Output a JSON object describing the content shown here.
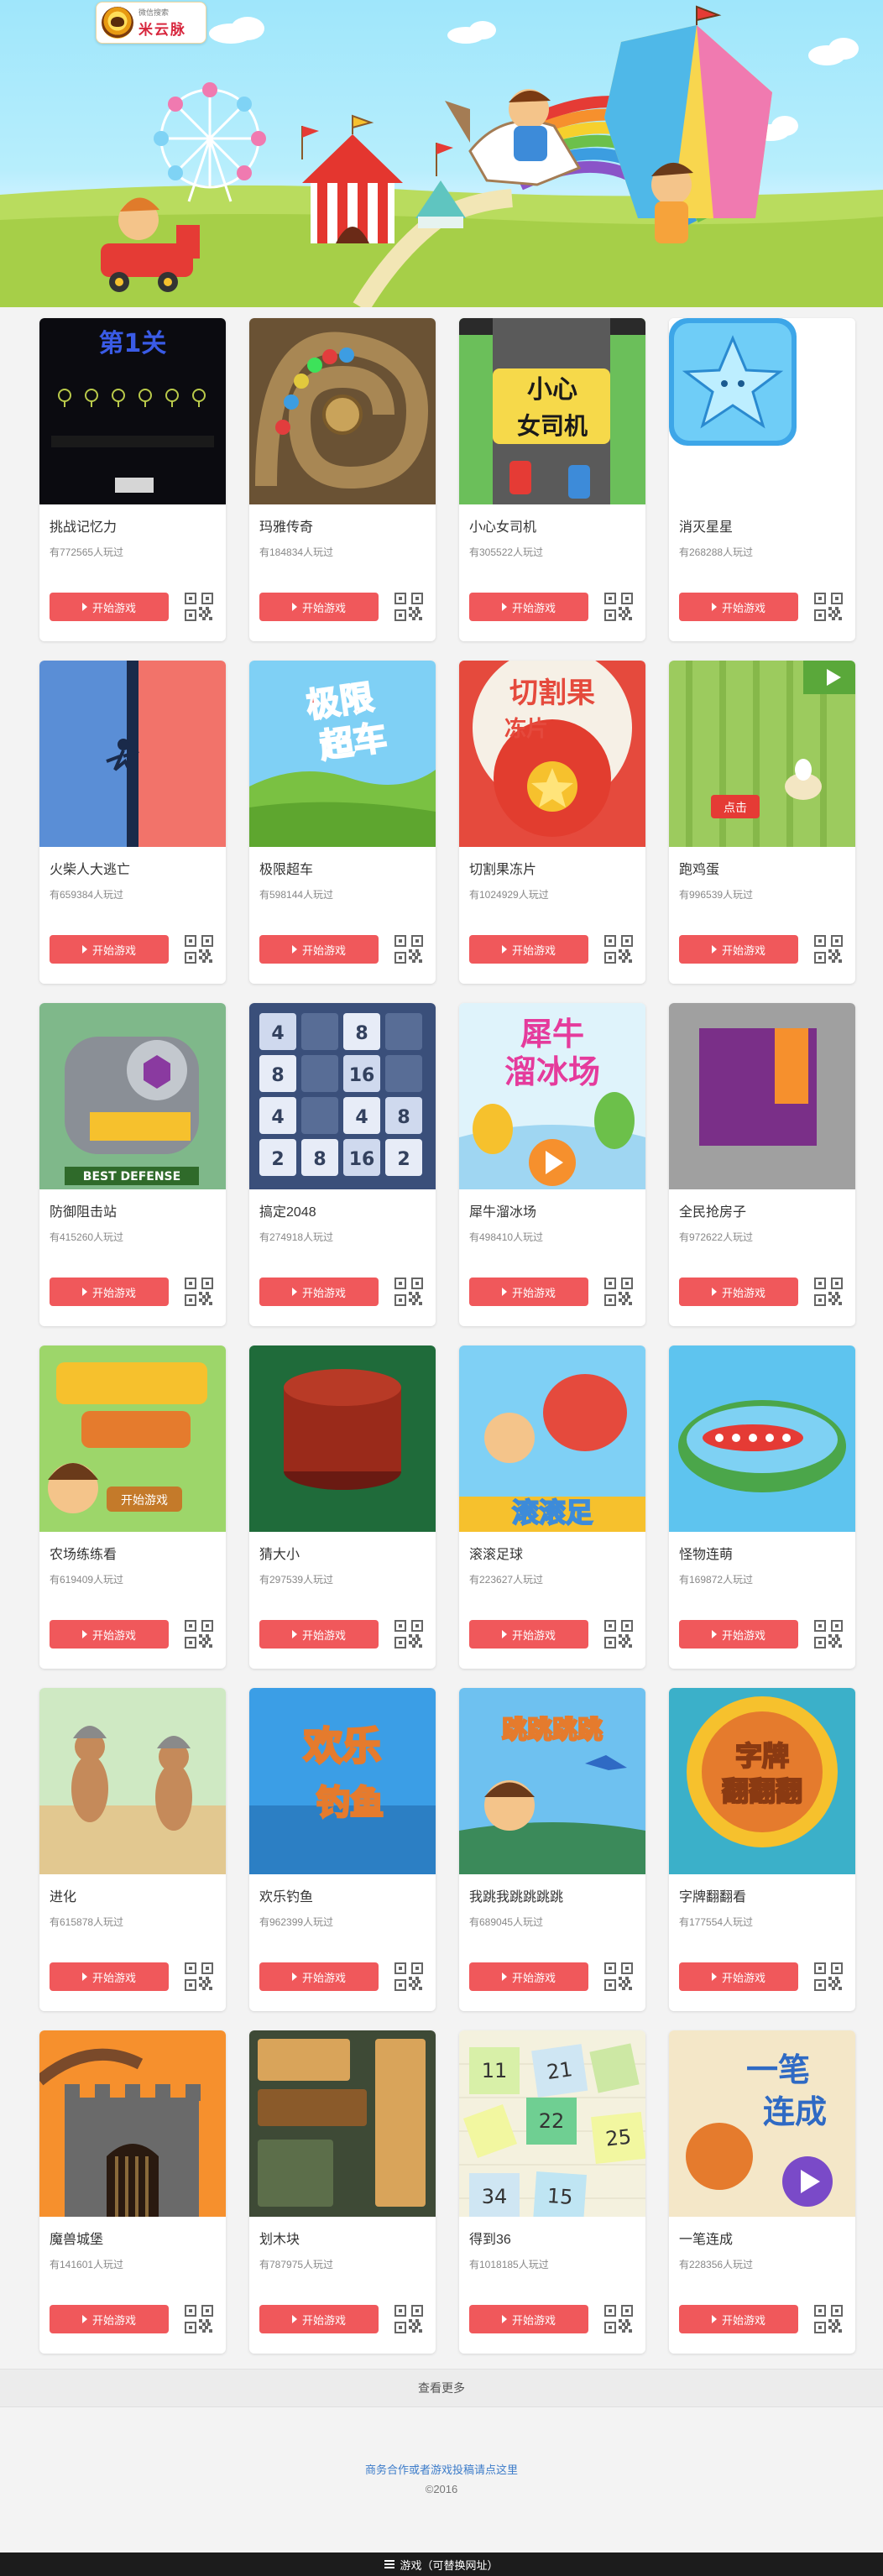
{
  "header": {
    "logo_sub": "微信搜索",
    "logo_main": "米云脉"
  },
  "play_label": "开始游戏",
  "games": [
    {
      "title": "挑战记忆力",
      "plays": "有772565人玩过",
      "thumb_text": "第1关"
    },
    {
      "title": "玛雅传奇",
      "plays": "有184834人玩过"
    },
    {
      "title": "小心女司机",
      "plays": "有305522人玩过",
      "thumb_text": "小心女司机"
    },
    {
      "title": "消灭星星",
      "plays": "有268288人玩过"
    },
    {
      "title": "火柴人大逃亡",
      "plays": "有659384人玩过"
    },
    {
      "title": "极限超车",
      "plays": "有598144人玩过",
      "thumb_text": "极限超车"
    },
    {
      "title": "切割果冻片",
      "plays": "有1024929人玩过",
      "thumb_text": "切割果冻片"
    },
    {
      "title": "跑鸡蛋",
      "plays": "有996539人玩过",
      "thumb_text": "点击"
    },
    {
      "title": "防御阻击站",
      "plays": "有415260人玩过",
      "thumb_text": "BEST DEFENSE"
    },
    {
      "title": "搞定2048",
      "plays": "有274918人玩过"
    },
    {
      "title": "犀牛溜冰场",
      "plays": "有498410人玩过",
      "thumb_text": "犀牛溜冰场"
    },
    {
      "title": "全民抢房子",
      "plays": "有972622人玩过"
    },
    {
      "title": "农场练练看",
      "plays": "有619409人玩过",
      "thumb_text": "开始游戏"
    },
    {
      "title": "猜大小",
      "plays": "有297539人玩过"
    },
    {
      "title": "滚滚足球",
      "plays": "有223627人玩过",
      "thumb_text": "滚滚足"
    },
    {
      "title": "怪物连萌",
      "plays": "有169872人玩过"
    },
    {
      "title": "进化",
      "plays": "有615878人玩过"
    },
    {
      "title": "欢乐钓鱼",
      "plays": "有962399人玩过",
      "thumb_text": "欢乐钓鱼"
    },
    {
      "title": "我跳我跳跳跳跳",
      "plays": "有689045人玩过",
      "thumb_text": "跳跳跳跳"
    },
    {
      "title": "字牌翻翻看",
      "plays": "有177554人玩过",
      "thumb_text": "字牌翻翻翻"
    },
    {
      "title": "魔兽城堡",
      "plays": "有141601人玩过"
    },
    {
      "title": "划木块",
      "plays": "有787975人玩过"
    },
    {
      "title": "得到36",
      "plays": "有1018185人玩过"
    },
    {
      "title": "一笔连成",
      "plays": "有228356人玩过",
      "thumb_text": "一笔连成"
    }
  ],
  "game_2048_tiles": [
    "4",
    "8",
    "8",
    "16",
    "4",
    "4",
    "8",
    "2",
    "8",
    "16",
    "2"
  ],
  "game_36_tiles": [
    "11",
    "21",
    "22",
    "25",
    "34",
    "15"
  ],
  "more_label": "查看更多",
  "footer": {
    "link": "商务合作或者游戏投稿请点这里",
    "year": "©2016"
  },
  "bottom_bar": {
    "label": "游戏（可替换网址）"
  },
  "colors": {
    "play_button": "#f0585b",
    "sky": "#9fe6fb",
    "grass": "#b9dc5e",
    "footer_link": "#3d7cc9"
  }
}
